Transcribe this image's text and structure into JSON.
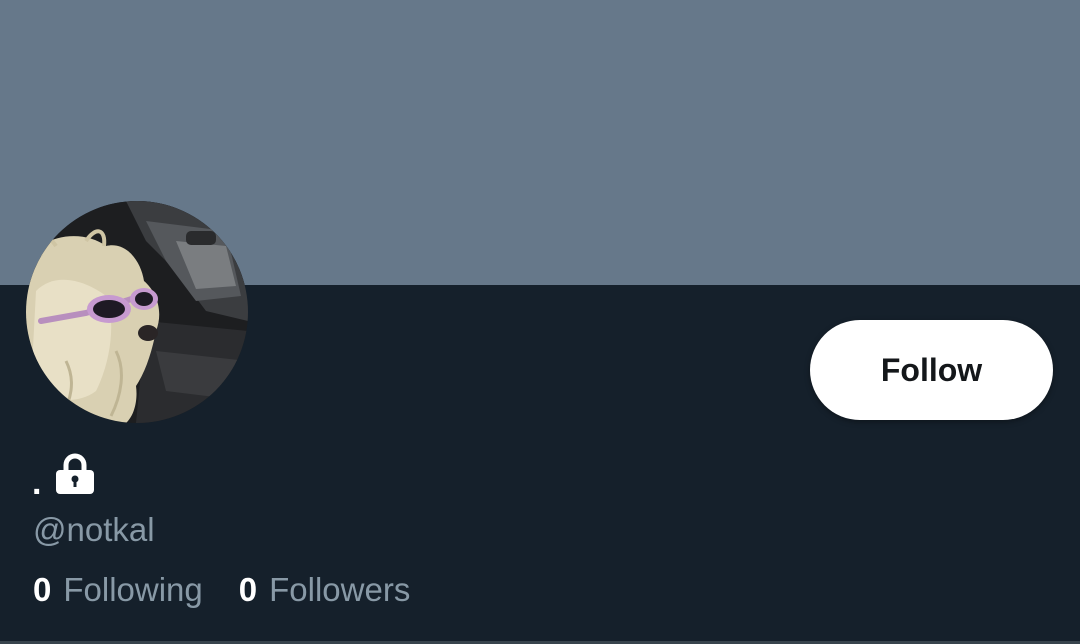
{
  "profile": {
    "display_name": ".",
    "handle": "@notkal",
    "lock_icon": "lock-icon",
    "avatar_icon": "avatar-dog-sunglasses"
  },
  "follow_button": {
    "label": "Follow"
  },
  "stats": {
    "following": {
      "count": "0",
      "label": "Following"
    },
    "followers": {
      "count": "0",
      "label": "Followers"
    }
  },
  "colors": {
    "banner": "#66788a",
    "background": "#15202b",
    "button_bg": "#ffffff",
    "button_text": "#14171a",
    "secondary_text": "#8899a6"
  }
}
